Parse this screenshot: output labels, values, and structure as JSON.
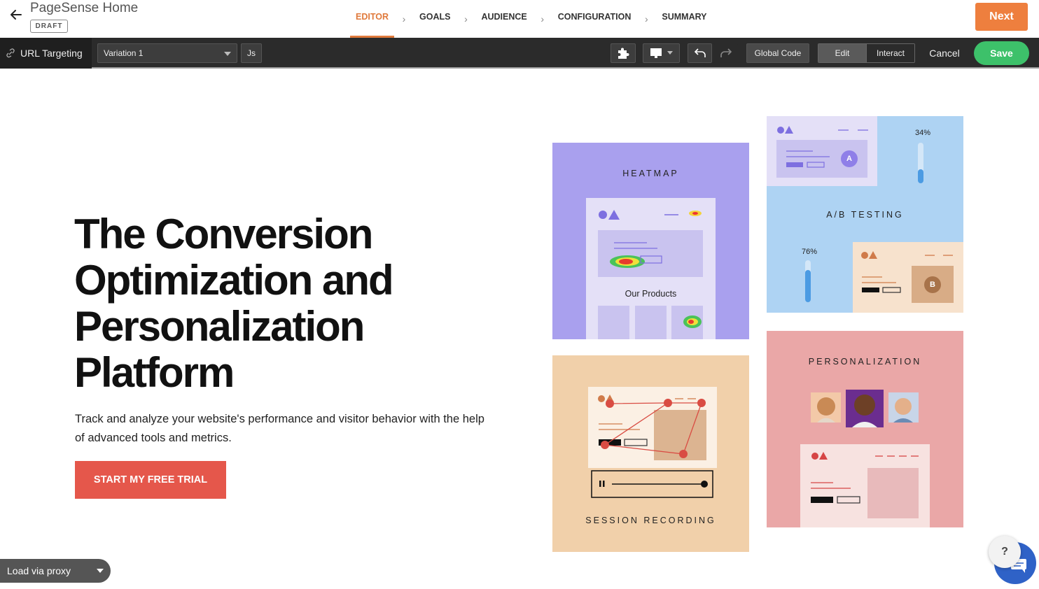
{
  "header": {
    "app_title": "PageSense Home",
    "badge": "DRAFT",
    "steps": [
      "EDITOR",
      "GOALS",
      "AUDIENCE",
      "CONFIGURATION",
      "SUMMARY"
    ],
    "active_step": "EDITOR",
    "next_label": "Next",
    "accent_color": "#e07a3c"
  },
  "toolbar": {
    "url_targeting": "URL Targeting",
    "variation_value": "Variation 1",
    "js_label": "Js",
    "global_code": "Global Code",
    "edit_label": "Edit",
    "interact_label": "Interact",
    "cancel_label": "Cancel",
    "save_label": "Save"
  },
  "hero": {
    "title_lines": [
      "The Conversion",
      "Optimization and",
      "Personalization",
      "Platform"
    ],
    "description": "Track and analyze your website's performance and visitor behavior with the help of advanced tools and metrics.",
    "cta": "START MY FREE TRIAL"
  },
  "cards": {
    "heatmap": {
      "label": "HEATMAP",
      "products": "Our Products"
    },
    "ab": {
      "label": "A/B TESTING",
      "pct_a": "34%",
      "pct_b": "76%",
      "a": "A",
      "b": "B"
    },
    "personalization": {
      "label": "PERSONALIZATION"
    },
    "session": {
      "label": "SESSION RECORDING"
    }
  },
  "footer": {
    "proxy_label": "Load via proxy",
    "help": "?"
  }
}
